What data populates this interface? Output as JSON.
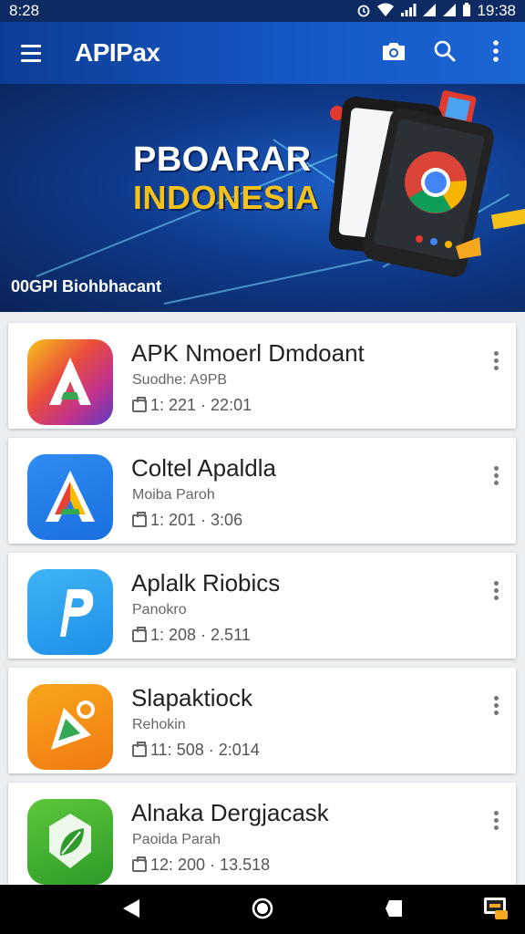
{
  "status_bar": {
    "left_time": "8:28",
    "right_time": "19:38"
  },
  "app_bar": {
    "title": "APIPax"
  },
  "banner": {
    "title_line1": "PBOARAR",
    "title_line2": "INDONESIA",
    "caption": "00GPI Biohbhacant"
  },
  "apps": [
    {
      "name": "APK Nmoerl Dmdoant",
      "developer": "Suodhe: A9PB",
      "meta": "1:  221 · 22:01"
    },
    {
      "name": "Coltel Apaldla",
      "developer": "Moiba Paroh",
      "meta": "1:  201 · 3:06"
    },
    {
      "name": "Aplalk Riobics",
      "developer": "Panokro",
      "meta": "1:  208 · 2.511"
    },
    {
      "name": "Slapaktiock",
      "developer": "Rehokin",
      "meta": "11: 508 · 2:014"
    },
    {
      "name": "Alnaka Dergjacask",
      "developer": "Paoida Parah",
      "meta": "12: 200 · 13.518"
    }
  ],
  "colors": {
    "app_bar": "#1457c4",
    "status_bar": "#0d2a63",
    "banner_accent": "#f6c21a",
    "nav_bar": "#000000"
  }
}
